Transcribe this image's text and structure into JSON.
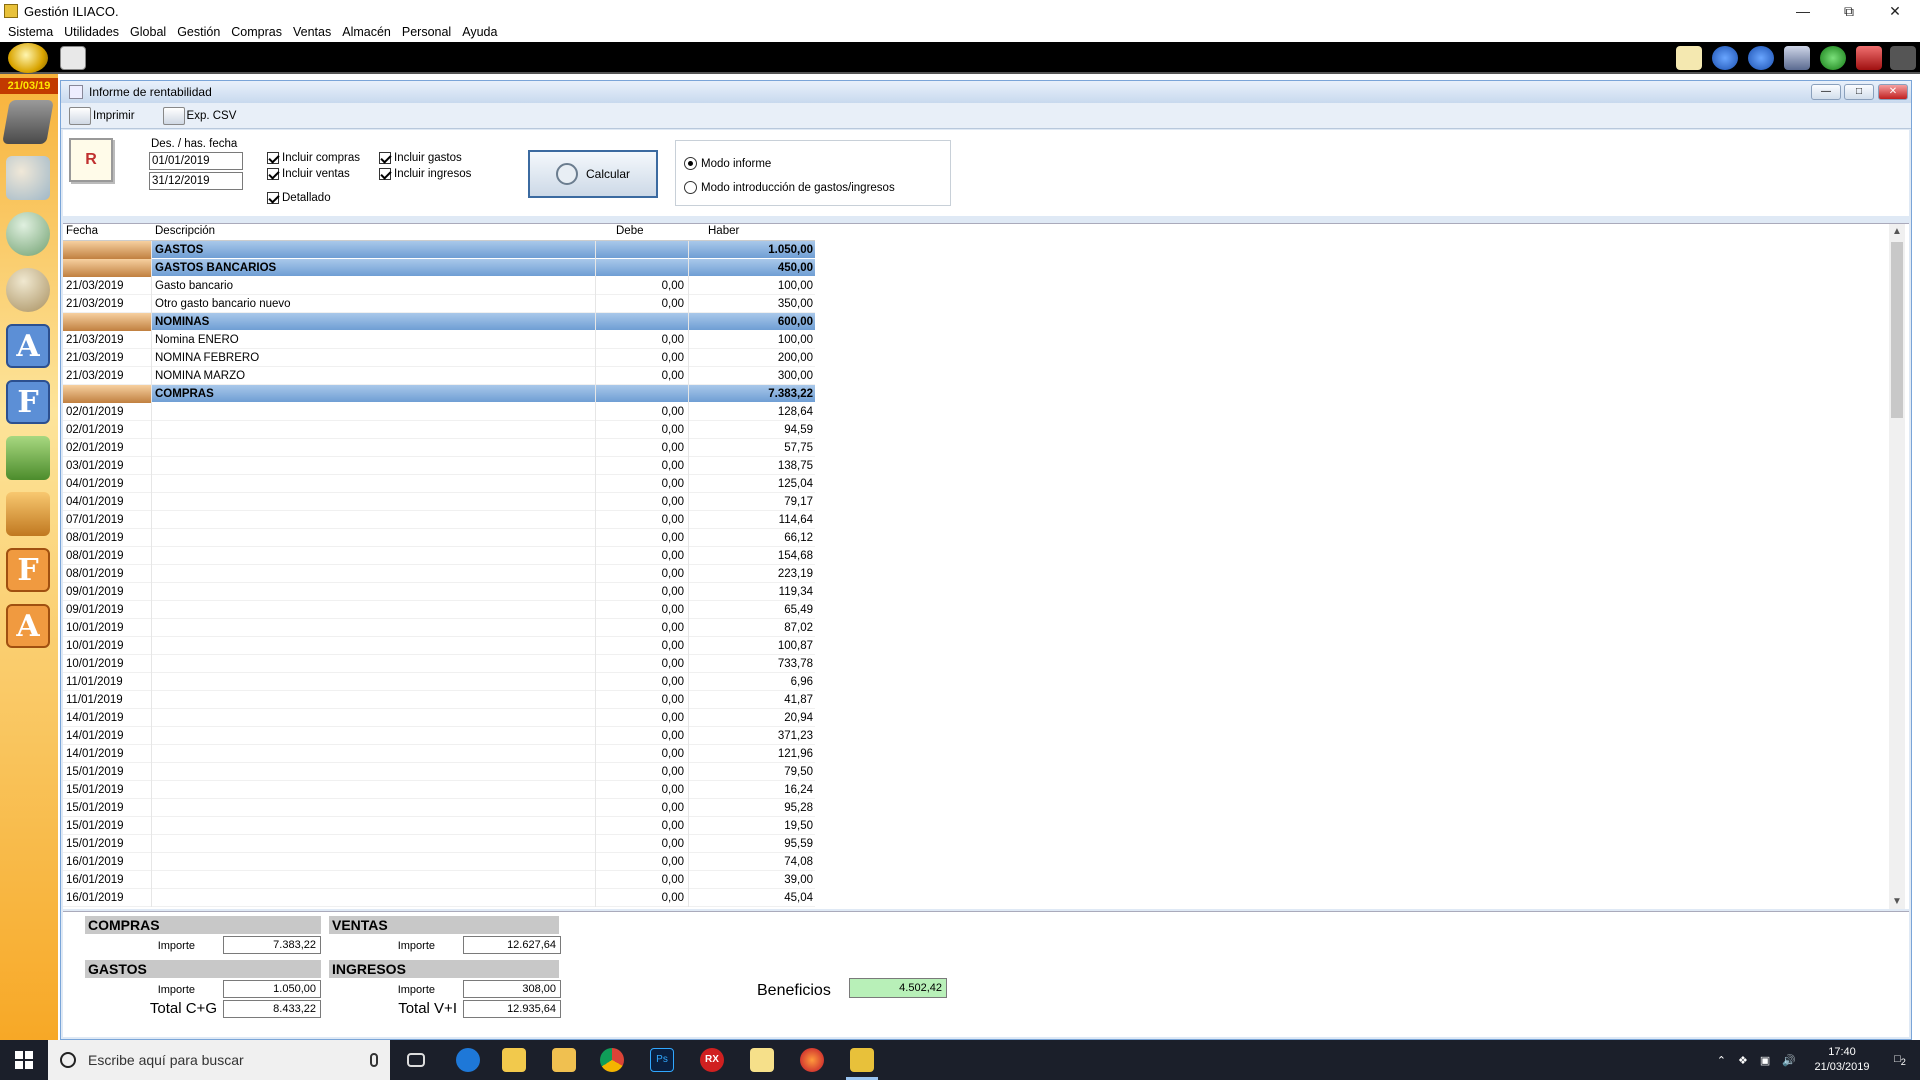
{
  "window": {
    "title": "Gestión ILIACO."
  },
  "menu": [
    "Sistema",
    "Utilidades",
    "Global",
    "Gestión",
    "Compras",
    "Ventas",
    "Almacén",
    "Personal",
    "Ayuda"
  ],
  "sidebar": {
    "date": "21/03/19"
  },
  "report": {
    "title": "Informe de rentabilidad",
    "tools": {
      "print": "Imprimir",
      "export": "Exp. CSV"
    },
    "date_label": "Des. / has. fecha",
    "date_from": "01/01/2019",
    "date_to": "31/12/2019",
    "checks": {
      "compras": "Incluir compras",
      "ventas": "Incluir ventas",
      "detallado": "Detallado",
      "gastos": "Incluir gastos",
      "ingresos": "Incluir ingresos"
    },
    "calc_label": "Calcular",
    "mode_report": "Modo informe",
    "mode_input": "Modo introducción de gastos/ingresos"
  },
  "grid": {
    "headers": {
      "fecha": "Fecha",
      "desc": "Descripción",
      "debe": "Debe",
      "haber": "Haber"
    },
    "rows": [
      {
        "g": true,
        "f": "",
        "d": "GASTOS",
        "db": "",
        "hb": "1.050,00"
      },
      {
        "g": true,
        "f": "",
        "d": "GASTOS BANCARIOS",
        "db": "",
        "hb": "450,00"
      },
      {
        "g": false,
        "f": "21/03/2019",
        "d": "Gasto bancario",
        "db": "0,00",
        "hb": "100,00"
      },
      {
        "g": false,
        "f": "21/03/2019",
        "d": "Otro gasto bancario nuevo",
        "db": "0,00",
        "hb": "350,00"
      },
      {
        "g": true,
        "f": "",
        "d": "NOMINAS",
        "db": "",
        "hb": "600,00"
      },
      {
        "g": false,
        "f": "21/03/2019",
        "d": "Nomina ENERO",
        "db": "0,00",
        "hb": "100,00"
      },
      {
        "g": false,
        "f": "21/03/2019",
        "d": "NOMINA FEBRERO",
        "db": "0,00",
        "hb": "200,00"
      },
      {
        "g": false,
        "f": "21/03/2019",
        "d": "NOMINA MARZO",
        "db": "0,00",
        "hb": "300,00"
      },
      {
        "g": true,
        "f": "",
        "d": "COMPRAS",
        "db": "",
        "hb": "7.383,22"
      },
      {
        "g": false,
        "f": "02/01/2019",
        "d": "",
        "db": "0,00",
        "hb": "128,64"
      },
      {
        "g": false,
        "f": "02/01/2019",
        "d": "",
        "db": "0,00",
        "hb": "94,59"
      },
      {
        "g": false,
        "f": "02/01/2019",
        "d": "",
        "db": "0,00",
        "hb": "57,75"
      },
      {
        "g": false,
        "f": "03/01/2019",
        "d": "",
        "db": "0,00",
        "hb": "138,75"
      },
      {
        "g": false,
        "f": "04/01/2019",
        "d": "",
        "db": "0,00",
        "hb": "125,04"
      },
      {
        "g": false,
        "f": "04/01/2019",
        "d": "",
        "db": "0,00",
        "hb": "79,17"
      },
      {
        "g": false,
        "f": "07/01/2019",
        "d": "",
        "db": "0,00",
        "hb": "114,64"
      },
      {
        "g": false,
        "f": "08/01/2019",
        "d": "",
        "db": "0,00",
        "hb": "66,12"
      },
      {
        "g": false,
        "f": "08/01/2019",
        "d": "",
        "db": "0,00",
        "hb": "154,68"
      },
      {
        "g": false,
        "f": "08/01/2019",
        "d": "",
        "db": "0,00",
        "hb": "223,19"
      },
      {
        "g": false,
        "f": "09/01/2019",
        "d": "",
        "db": "0,00",
        "hb": "119,34"
      },
      {
        "g": false,
        "f": "09/01/2019",
        "d": "",
        "db": "0,00",
        "hb": "65,49"
      },
      {
        "g": false,
        "f": "10/01/2019",
        "d": "",
        "db": "0,00",
        "hb": "87,02"
      },
      {
        "g": false,
        "f": "10/01/2019",
        "d": "",
        "db": "0,00",
        "hb": "100,87"
      },
      {
        "g": false,
        "f": "10/01/2019",
        "d": "",
        "db": "0,00",
        "hb": "733,78"
      },
      {
        "g": false,
        "f": "11/01/2019",
        "d": "",
        "db": "0,00",
        "hb": "6,96"
      },
      {
        "g": false,
        "f": "11/01/2019",
        "d": "",
        "db": "0,00",
        "hb": "41,87"
      },
      {
        "g": false,
        "f": "14/01/2019",
        "d": "",
        "db": "0,00",
        "hb": "20,94"
      },
      {
        "g": false,
        "f": "14/01/2019",
        "d": "",
        "db": "0,00",
        "hb": "371,23"
      },
      {
        "g": false,
        "f": "14/01/2019",
        "d": "",
        "db": "0,00",
        "hb": "121,96"
      },
      {
        "g": false,
        "f": "15/01/2019",
        "d": "",
        "db": "0,00",
        "hb": "79,50"
      },
      {
        "g": false,
        "f": "15/01/2019",
        "d": "",
        "db": "0,00",
        "hb": "16,24"
      },
      {
        "g": false,
        "f": "15/01/2019",
        "d": "",
        "db": "0,00",
        "hb": "95,28"
      },
      {
        "g": false,
        "f": "15/01/2019",
        "d": "",
        "db": "0,00",
        "hb": "19,50"
      },
      {
        "g": false,
        "f": "15/01/2019",
        "d": "",
        "db": "0,00",
        "hb": "95,59"
      },
      {
        "g": false,
        "f": "16/01/2019",
        "d": "",
        "db": "0,00",
        "hb": "74,08"
      },
      {
        "g": false,
        "f": "16/01/2019",
        "d": "",
        "db": "0,00",
        "hb": "39,00"
      },
      {
        "g": false,
        "f": "16/01/2019",
        "d": "",
        "db": "0,00",
        "hb": "45,04"
      }
    ]
  },
  "totals": {
    "compras": {
      "title": "COMPRAS",
      "label": "Importe",
      "value": "7.383,22"
    },
    "ventas": {
      "title": "VENTAS",
      "label": "Importe",
      "value": "12.627,64"
    },
    "gastos": {
      "title": "GASTOS",
      "label": "Importe",
      "value": "1.050,00"
    },
    "ingresos": {
      "title": "INGRESOS",
      "label": "Importe",
      "value": "308,00"
    },
    "total_cg_label": "Total C+G",
    "total_cg": "8.433,22",
    "total_vi_label": "Total V+I",
    "total_vi": "12.935,64",
    "benef_label": "Beneficios",
    "benef": "4.502,42"
  },
  "taskbar": {
    "search_placeholder": "Escribe aquí para buscar",
    "time": "17:40",
    "date": "21/03/2019",
    "notif_count": "2"
  }
}
